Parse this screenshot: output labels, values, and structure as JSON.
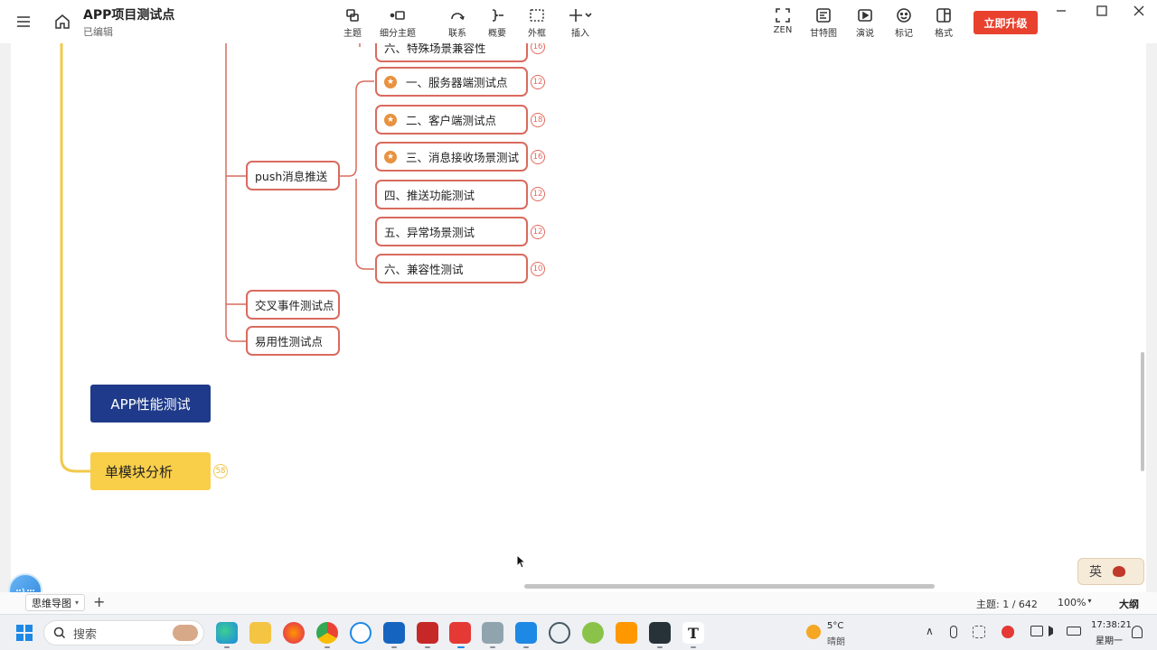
{
  "app": {
    "title": "APP项目测试点",
    "status": "已编辑"
  },
  "toolbar": {
    "tools": [
      {
        "label": "主题",
        "icon": "topic-icon"
      },
      {
        "label": "细分主题",
        "icon": "subtopic-icon"
      },
      {
        "label": "联系",
        "icon": "relationship-icon"
      },
      {
        "label": "概要",
        "icon": "summary-icon"
      },
      {
        "label": "外框",
        "icon": "boundary-icon"
      },
      {
        "label": "插入",
        "icon": "insert-icon"
      }
    ],
    "right_tools": [
      {
        "label": "ZEN",
        "icon": "zen-icon"
      },
      {
        "label": "甘特图",
        "icon": "gantt-icon"
      },
      {
        "label": "演说",
        "icon": "pitch-icon"
      },
      {
        "label": "标记",
        "icon": "marker-icon"
      },
      {
        "label": "格式",
        "icon": "format-icon"
      }
    ],
    "upgrade_label": "立即升级"
  },
  "mindmap": {
    "partial_top": {
      "label": "六、特殊场景兼容性",
      "count": "16"
    },
    "push_group": {
      "label": "push消息推送",
      "children": [
        {
          "label": "一、服务器端测试点",
          "count": "12",
          "starred": true
        },
        {
          "label": "二、客户端测试点",
          "count": "18",
          "starred": true
        },
        {
          "label": "三、消息接收场景测试",
          "count": "16",
          "starred": true
        },
        {
          "label": "四、推送功能测试",
          "count": "12",
          "starred": false
        },
        {
          "label": "五、异常场景测试",
          "count": "12",
          "starred": false
        },
        {
          "label": "六、兼容性测试",
          "count": "10",
          "starred": false
        }
      ]
    },
    "cross_event": "交叉事件测试点",
    "usability": "易用性测试点",
    "performance": "APP性能测试",
    "module": {
      "label": "单模块分析",
      "count": "58"
    }
  },
  "bottombar": {
    "sheet_label": "思维导图",
    "topic_count": "主题: 1 / 642",
    "zoom": "100%",
    "outline": "大纲"
  },
  "ime": {
    "label": "英"
  },
  "taskbar": {
    "search_placeholder": "搜索",
    "weather_temp": "5°C",
    "weather_desc": "晴朗",
    "time": "17:38:21",
    "day": "星期一"
  },
  "colors": {
    "node_border": "#d96b5f",
    "badge": "#e46a5d",
    "star": "#e8923f",
    "branch": "#f2c94c",
    "performance_bg": "#1f3a8a",
    "module_bg": "#f9cf4a",
    "upgrade_bg": "#e8412e"
  }
}
